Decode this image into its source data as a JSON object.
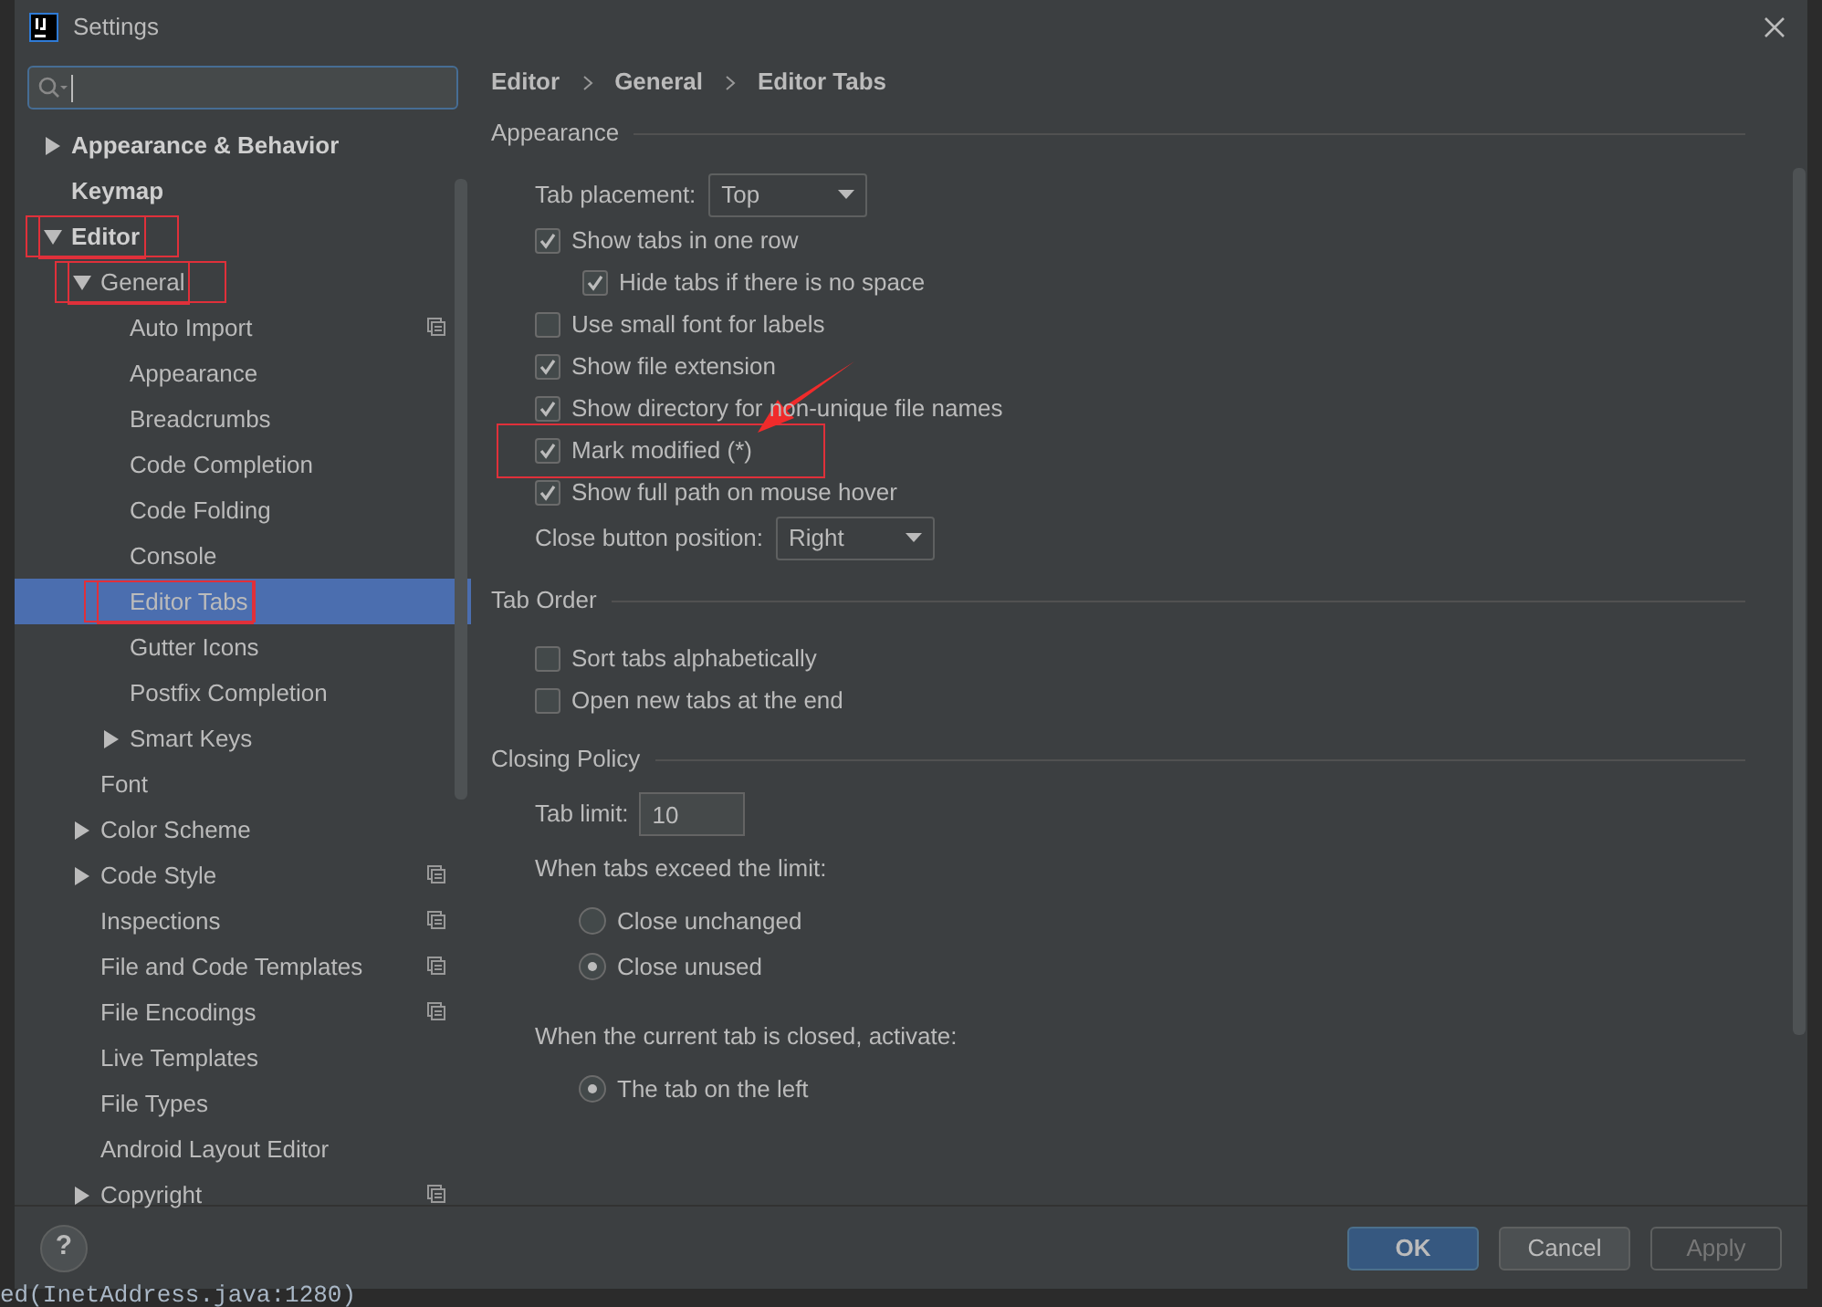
{
  "window": {
    "title": "Settings"
  },
  "tree": [
    {
      "label": "Appearance & Behavior",
      "expanded": false,
      "highlighted": false,
      "selected": false
    },
    {
      "label": "Keymap",
      "highlighted": false,
      "selected": false
    },
    {
      "label": "Editor",
      "expanded": true,
      "highlighted": true,
      "selected": false,
      "children": [
        {
          "label": "General",
          "expanded": true,
          "highlighted": true,
          "selected": false,
          "children": [
            {
              "label": "Auto Import",
              "project": true,
              "selected": false,
              "highlighted": false
            },
            {
              "label": "Appearance",
              "selected": false,
              "highlighted": false
            },
            {
              "label": "Breadcrumbs",
              "selected": false,
              "highlighted": false
            },
            {
              "label": "Code Completion",
              "selected": false,
              "highlighted": false
            },
            {
              "label": "Code Folding",
              "selected": false,
              "highlighted": false
            },
            {
              "label": "Console",
              "selected": false,
              "highlighted": false
            },
            {
              "label": "Editor Tabs",
              "selected": true,
              "highlighted": true
            },
            {
              "label": "Gutter Icons",
              "selected": false,
              "highlighted": false
            },
            {
              "label": "Postfix Completion",
              "selected": false,
              "highlighted": false
            },
            {
              "label": "Smart Keys",
              "expanded": false,
              "selected": false,
              "highlighted": false
            }
          ]
        },
        {
          "label": "Font",
          "selected": false,
          "highlighted": false
        },
        {
          "label": "Color Scheme",
          "expanded": false,
          "selected": false,
          "highlighted": false
        },
        {
          "label": "Code Style",
          "expanded": false,
          "project": true,
          "selected": false,
          "highlighted": false
        },
        {
          "label": "Inspections",
          "project": true,
          "selected": false,
          "highlighted": false
        },
        {
          "label": "File and Code Templates",
          "project": true,
          "selected": false,
          "highlighted": false
        },
        {
          "label": "File Encodings",
          "project": true,
          "selected": false,
          "highlighted": false
        },
        {
          "label": "Live Templates",
          "selected": false,
          "highlighted": false
        },
        {
          "label": "File Types",
          "selected": false,
          "highlighted": false
        },
        {
          "label": "Android Layout Editor",
          "selected": false,
          "highlighted": false
        },
        {
          "label": "Copyright",
          "expanded": false,
          "project": true,
          "selected": false,
          "highlighted": false
        }
      ]
    }
  ],
  "breadcrumb": [
    "Editor",
    "General",
    "Editor Tabs"
  ],
  "sections": [
    {
      "title": "Appearance",
      "items": [
        {
          "kind": "dropdown",
          "label": "Tab placement:",
          "value": "Top"
        },
        {
          "kind": "checkbox",
          "label": "Show tabs in one row",
          "checked": true
        },
        {
          "kind": "checkbox",
          "label": "Hide tabs if there is no space",
          "checked": true,
          "nested": true
        },
        {
          "kind": "checkbox",
          "label": "Use small font for labels",
          "checked": false
        },
        {
          "kind": "checkbox",
          "label": "Show file extension",
          "checked": true
        },
        {
          "kind": "checkbox",
          "label": "Show directory for non-unique file names",
          "checked": true
        },
        {
          "kind": "checkbox",
          "label": "Mark modified (*)",
          "checked": true,
          "highlighted": true
        },
        {
          "kind": "checkbox",
          "label": "Show full path on mouse hover",
          "checked": true
        },
        {
          "kind": "dropdown",
          "label": "Close button position:",
          "value": "Right"
        }
      ]
    },
    {
      "title": "Tab Order",
      "items": [
        {
          "kind": "checkbox",
          "label": "Sort tabs alphabetically",
          "checked": false
        },
        {
          "kind": "checkbox",
          "label": "Open new tabs at the end",
          "checked": false
        }
      ]
    },
    {
      "title": "Closing Policy",
      "items": [
        {
          "kind": "textfield",
          "label": "Tab limit:",
          "value": "10"
        },
        {
          "kind": "label",
          "label": "When tabs exceed the limit:"
        },
        {
          "kind": "radio",
          "label": "Close unchanged",
          "selected": false
        },
        {
          "kind": "radio",
          "label": "Close unused",
          "selected": true
        },
        {
          "kind": "label",
          "label": "When the current tab is closed, activate:",
          "gap": true
        },
        {
          "kind": "radio",
          "label": "The tab on the left",
          "selected": true
        }
      ]
    }
  ],
  "help_button": {
    "label": "?"
  },
  "buttons": [
    {
      "label": "OK",
      "kind": "default"
    },
    {
      "label": "Cancel",
      "kind": "normal"
    },
    {
      "label": "Apply",
      "kind": "disabled"
    }
  ],
  "background_editor": {
    "line": "ed(InetAddress.java:1280)"
  }
}
